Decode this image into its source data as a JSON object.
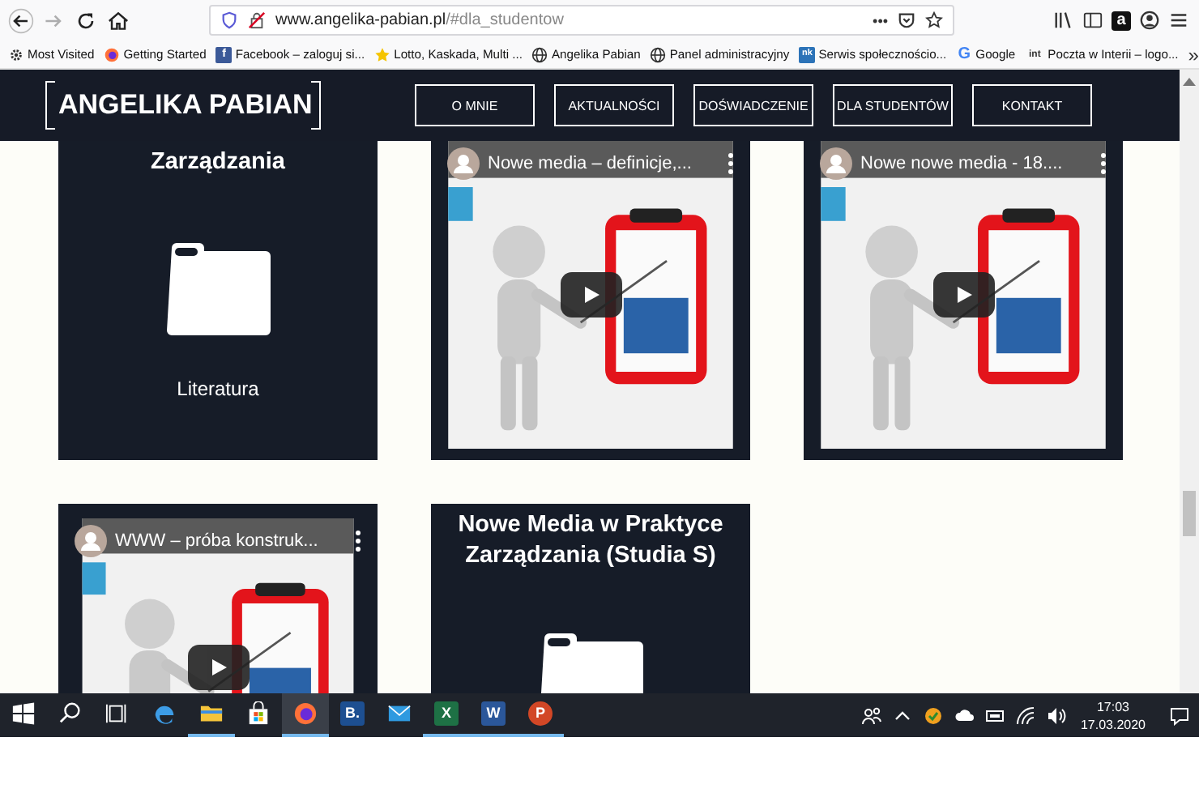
{
  "browser": {
    "nav_buttons": [
      {
        "disabled": false
      },
      {
        "disabled": true
      },
      {
        "disabled": false
      },
      {
        "disabled": false
      }
    ],
    "url": {
      "host": "www.angelika-pabian.pl",
      "path": "/#dla_studentow"
    },
    "page_actions": "•••",
    "extension_glyph": "a",
    "bookmarks": [
      {
        "label": "Most Visited"
      },
      {
        "label": "Getting Started"
      },
      {
        "glyph": "f",
        "label": "Facebook – zaloguj si..."
      },
      {
        "label": "Lotto, Kaskada, Multi ..."
      },
      {
        "label": "Angelika Pabian"
      },
      {
        "label": "Panel administracyjny"
      },
      {
        "glyph": "nk",
        "label": "Serwis społecznościo..."
      },
      {
        "glyph": "G",
        "label": "Google"
      },
      {
        "glyph": "int",
        "label": "Poczta w Interii – logo..."
      }
    ],
    "bookmarks_overflow": "»"
  },
  "site": {
    "logo": "ANGELIKA PABIAN",
    "nav": [
      "O MNIE",
      "AKTUALNOŚCI",
      "DOŚWIADCZENIE",
      "DLA STUDENTÓW",
      "KONTAKT"
    ],
    "cards": [
      {
        "kind": "folder",
        "title": "Zarządzania",
        "label": "Literatura"
      },
      {
        "kind": "video",
        "title": "Nowe media – definicje,..."
      },
      {
        "kind": "video",
        "title": "Nowe nowe media - 18...."
      },
      {
        "kind": "video",
        "title": "WWW – próba konstruk..."
      },
      {
        "kind": "folder",
        "title": "Nowe Media w Praktyce Zarządzania (Studia S)"
      }
    ]
  },
  "taskbar": {
    "items": [
      {
        "running": false,
        "selected": false
      },
      {
        "running": false,
        "selected": false
      },
      {
        "running": false,
        "selected": false
      },
      {
        "running": false,
        "selected": false
      },
      {
        "running": true,
        "selected": false
      },
      {
        "running": false,
        "selected": false
      },
      {
        "running": true,
        "selected": true
      },
      {
        "glyph": "B.",
        "running": false,
        "selected": false
      },
      {
        "running": false,
        "selected": false
      },
      {
        "glyph": "X",
        "running": true,
        "selected": false
      },
      {
        "glyph": "W",
        "running": true,
        "selected": false
      },
      {
        "glyph": "P",
        "running": true,
        "selected": false
      }
    ],
    "time": "17:03",
    "date": "17.03.2020"
  }
}
